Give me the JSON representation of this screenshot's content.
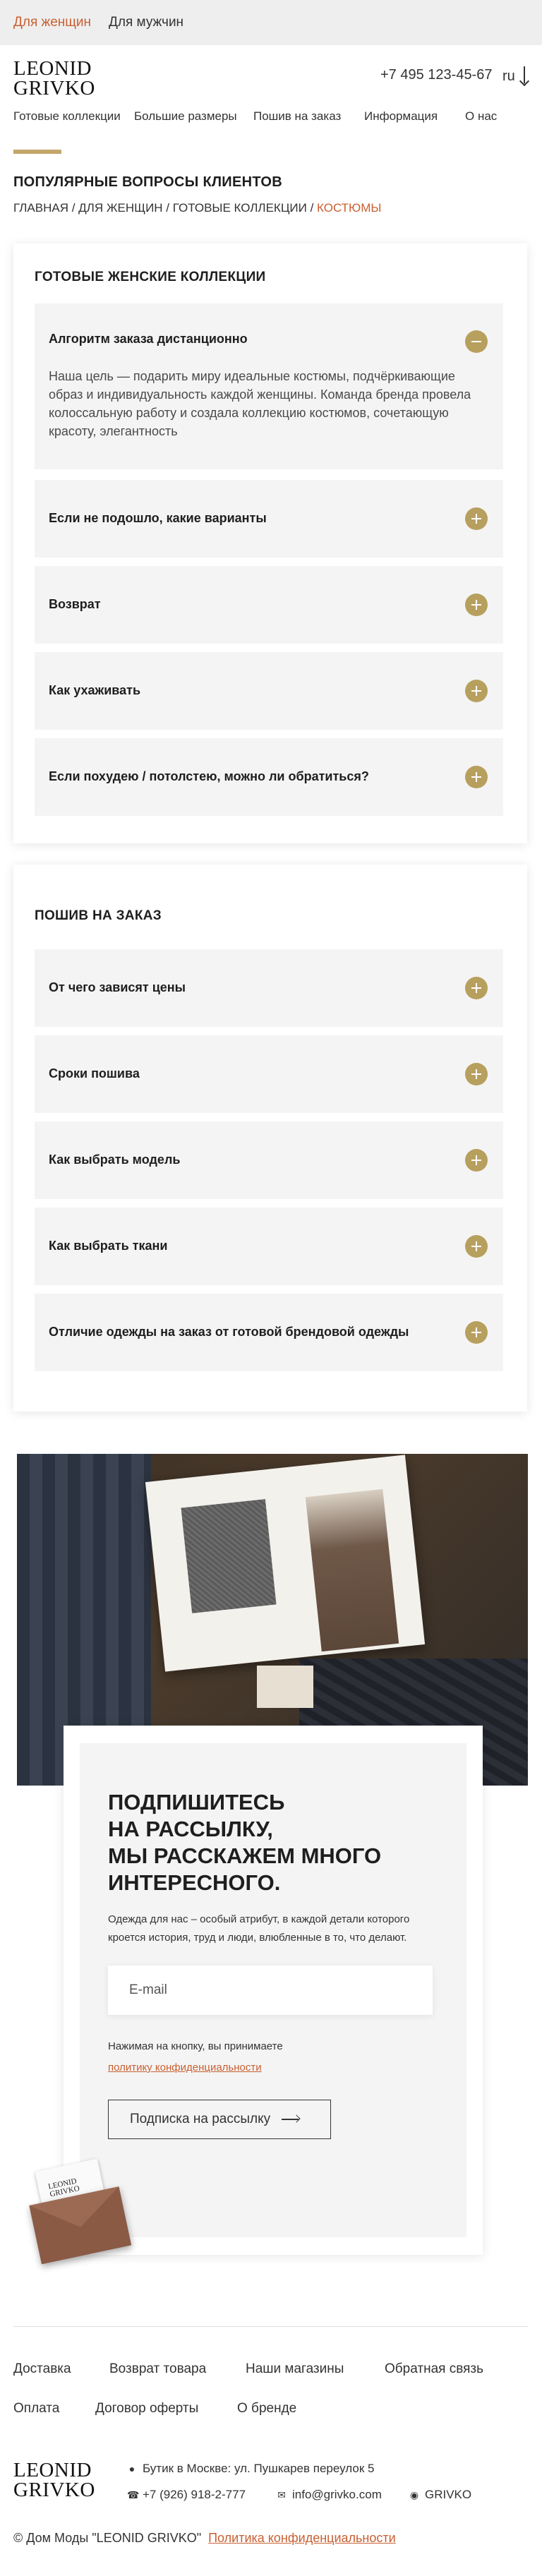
{
  "topbar": {
    "women": "Для женщин",
    "men": "Для мужчин"
  },
  "header": {
    "logo_line1": "LEONID",
    "logo_line2": "GRIVKO",
    "phone": "+7 495 123-45-67",
    "lang": "ru"
  },
  "nav": {
    "items": [
      "Готовые коллекции",
      "Большие размеры",
      "Пошив на заказ",
      "Информация",
      "О нас"
    ]
  },
  "page": {
    "title": "ПОПУЛЯРНЫЕ ВОПРОСЫ КЛИЕНТОВ",
    "breadcrumb": {
      "home": "ГЛАВНАЯ",
      "sep": " / ",
      "women": "ДЛЯ ЖЕНЩИН",
      "collections": "ГОТОВЫЕ КОЛЛЕКЦИИ",
      "current": "КОСТЮМЫ"
    }
  },
  "faq_ready": {
    "title": "ГОТОВЫЕ ЖЕНСКИЕ КОЛЛЕКЦИИ",
    "items": [
      {
        "question": "Алгоритм заказа дистанционно",
        "answer": "Наша цель — подарить миру идеальные костюмы, подчёркивающие образ и индивидуальность каждой женщины. Команда бренда провела колоссальную работу и создала коллекцию костюмов, сочетающую красоту, элегантность",
        "expanded": true
      },
      {
        "question": "Если не подошло, какие варианты",
        "expanded": false
      },
      {
        "question": "Возврат",
        "expanded": false
      },
      {
        "question": "Как ухаживать",
        "expanded": false
      },
      {
        "question": "Если похудею / потолстею, можно ли обратиться?",
        "expanded": false
      }
    ]
  },
  "faq_tailoring": {
    "title": "ПОШИВ НА ЗАКАЗ",
    "items": [
      {
        "question": "От чего зависят цены",
        "expanded": false
      },
      {
        "question": "Сроки пошива",
        "expanded": false
      },
      {
        "question": "Как выбрать модель",
        "expanded": false
      },
      {
        "question": "Как выбрать ткани",
        "expanded": false
      },
      {
        "question": "Отличие одежды на заказ от готовой брендовой одежды",
        "expanded": false
      }
    ]
  },
  "subscribe": {
    "title_line1": "ПОДПИШИТЕСЬ",
    "title_line2": "НА РАССЫЛКУ,",
    "title_line3": "МЫ РАССКАЖЕМ МНОГО",
    "title_line4": "ИНТЕРЕСНОГО.",
    "description": "Одежда для нас – особый атрибут, в каждой детали которого кроется история, труд и люди, влюбленные в то, что делают.",
    "email_placeholder": "E-mail",
    "consent_text": "Нажимая на кнопку, вы принимаете",
    "consent_link": "политику конфиденциальности",
    "button_label": "Подписка на рассылку"
  },
  "envelope_logo": {
    "line1": "LEONID",
    "line2": "GRIVKO"
  },
  "footer": {
    "links_row1": [
      "Доставка",
      "Возврат товара",
      "Наши магазины",
      "Обратная связь"
    ],
    "links_row2": [
      "Оплата",
      "Договор оферты",
      "О бренде"
    ],
    "logo_line1": "LEONID",
    "logo_line2": "GRIVKO",
    "address": "Бутик в Москве: ул. Пушкарев переулок 5",
    "phone": "+7 (926) 918-2-777",
    "email": "info@grivko.com",
    "social": "GRIVKO",
    "copyright": "© Дом Моды \"LEONID GRIVKO\"",
    "privacy": "Политика конфиденциальности"
  },
  "colors": {
    "accent": "#c3a76a",
    "toggle": "#b79f5e",
    "link": "#c86032",
    "topbar_bg": "#eeeeee",
    "panel_bg": "#f4f4f4"
  },
  "icons": {
    "toggle_plus": "plus-circle-icon",
    "toggle_minus": "minus-circle-icon",
    "lang_arrow": "arrow-down-icon",
    "button_arrow": "arrow-right-icon",
    "address": "location-pin-icon",
    "phone": "phone-icon",
    "email": "envelope-icon",
    "social": "instagram-icon"
  }
}
